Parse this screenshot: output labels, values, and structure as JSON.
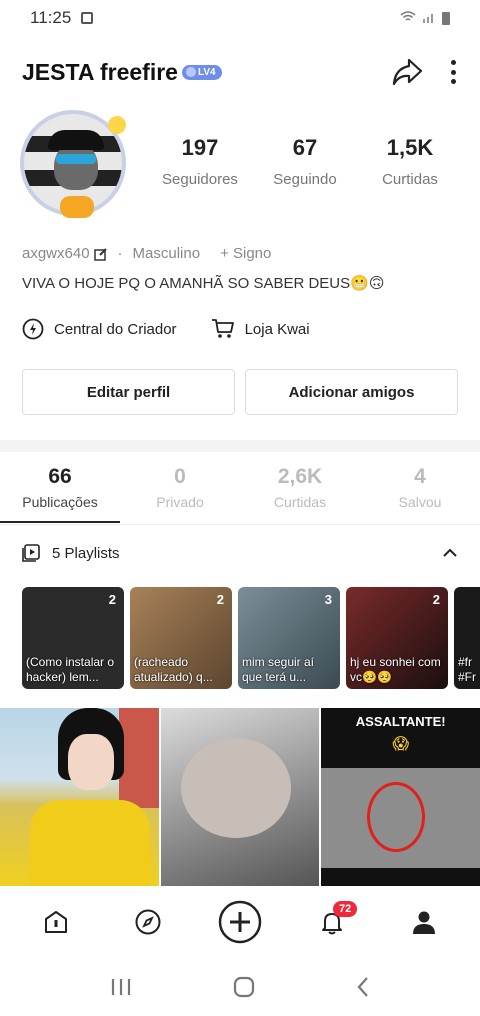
{
  "status_bar": {
    "time": "11:25"
  },
  "profile": {
    "username": "JESTA freefire",
    "level_badge": "LV4",
    "stats": [
      {
        "value": "197",
        "label": "Seguidores"
      },
      {
        "value": "67",
        "label": "Seguindo"
      },
      {
        "value": "1,5K",
        "label": "Curtidas"
      }
    ],
    "handle": "axgwx640",
    "gender": "Masculino",
    "sign": "+ Signo",
    "bio": "VIVA O HOJE PQ O AMANHÃ SO SABER DEUS😬🙃"
  },
  "links": {
    "creator_center": "Central do Criador",
    "shop": "Loja Kwai"
  },
  "buttons": {
    "edit_profile": "Editar perfil",
    "add_friends": "Adicionar amigos"
  },
  "tabs": [
    {
      "value": "66",
      "label": "Publicações",
      "active": true
    },
    {
      "value": "0",
      "label": "Privado"
    },
    {
      "value": "2,6K",
      "label": "Curtidas"
    },
    {
      "value": "4",
      "label": "Salvou"
    }
  ],
  "playlists": {
    "header": "5 Playlists",
    "items": [
      {
        "count": "2",
        "caption": "(Como instalar o hacker) lem...",
        "color": "#2b2b2b"
      },
      {
        "count": "2",
        "caption": "(racheado atualizado) q...",
        "color": "#8a6a4a"
      },
      {
        "count": "3",
        "caption": "mim seguir aí que terá u...",
        "color": "#5b6f7c"
      },
      {
        "count": "2",
        "caption": "hj eu sonhei com vc🥺🥺",
        "color": "#5a2424"
      },
      {
        "count": "",
        "caption": "#fr #Fr",
        "color": "#1a1a1a"
      }
    ]
  },
  "grid": {
    "third_title": "ASSALTANTE!",
    "third_emoji": "😱"
  },
  "nav": {
    "notification_count": "72"
  },
  "colors": {
    "badge": "#6f8ee8",
    "notif": "#f0283c"
  }
}
